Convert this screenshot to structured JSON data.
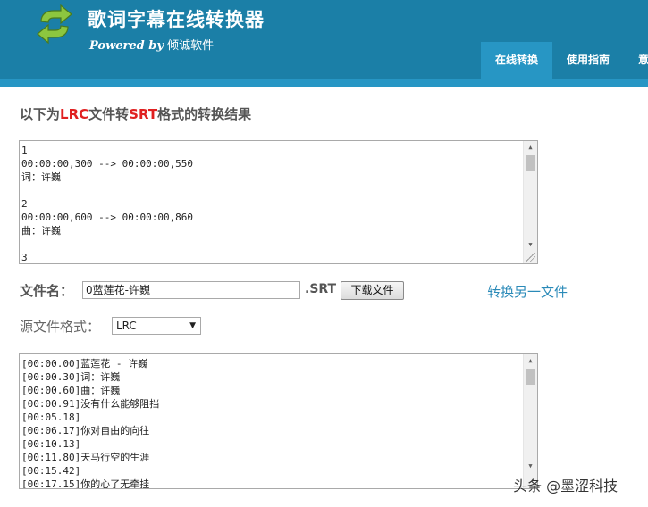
{
  "header": {
    "title": "歌词字幕在线转换器",
    "powered_by": "Powered by",
    "company": "倾诚软件",
    "nav": [
      "在线转换",
      "使用指南",
      "意"
    ],
    "colors": {
      "header_bg": "#1b7fa7",
      "active_tab": "#2796c4"
    }
  },
  "result": {
    "prefix": "以下为",
    "from_format": "LRC",
    "middle": "文件转",
    "to_format": "SRT",
    "suffix": "格式的转换结果",
    "output_text": "1\n00:00:00,300 --> 00:00:00,550\n词：许巍\n\n2\n00:00:00,600 --> 00:00:00,860\n曲：许巍\n\n3"
  },
  "file": {
    "label": "文件名：",
    "name_value": "0蓝莲花-许巍",
    "extension": ".SRT",
    "download_button": "下载文件",
    "convert_another": "转换另一文件"
  },
  "source": {
    "label": "源文件格式：",
    "selected": "LRC",
    "input_text": "[00:00.00]蓝莲花 - 许巍\n[00:00.30]词：许巍\n[00:00.60]曲：许巍\n[00:00.91]没有什么能够阻挡\n[00:05.18]\n[00:06.17]你对自由的向往\n[00:10.13]\n[00:11.80]天马行空的生涯\n[00:15.42]\n[00:17.15]你的心了无牵挂"
  },
  "watermark": "头条 @墨涩科技"
}
